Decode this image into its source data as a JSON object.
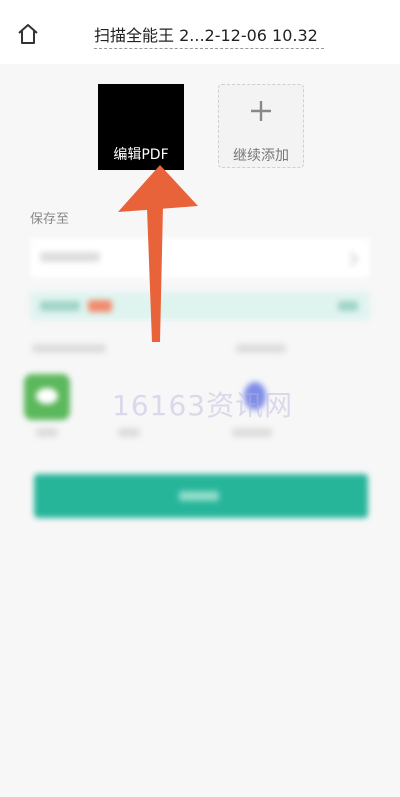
{
  "header": {
    "title": "扫描全能王 2...2-12-06 10.32",
    "home_icon": "home-icon"
  },
  "document": {
    "thumbnail_label": "编辑PDF",
    "add_more_label": "继续添加",
    "add_icon": "plus-icon"
  },
  "save": {
    "label": "保存至"
  },
  "watermark": "16163资讯网",
  "colors": {
    "accent_teal": "#27b59a",
    "arrow_orange": "#e8623a",
    "wechat_green": "#5cb85c"
  }
}
